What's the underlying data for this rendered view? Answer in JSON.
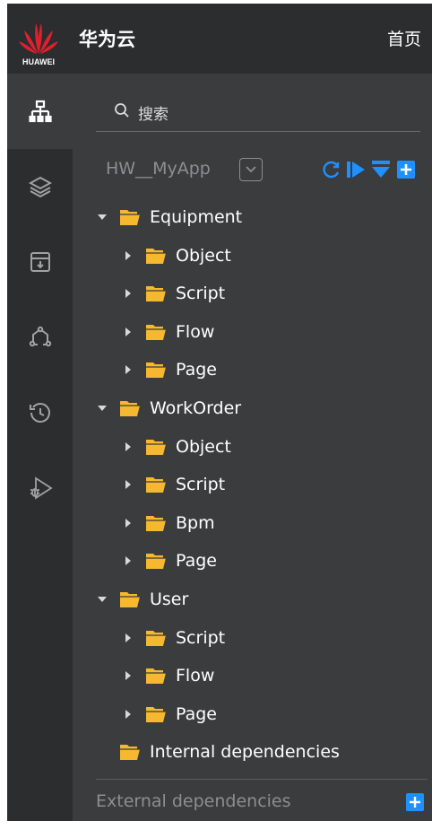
{
  "header": {
    "logo_text": "HUAWEI",
    "brand": "华为云",
    "nav_home": "首页"
  },
  "rail": {
    "items": [
      {
        "icon": "sitemap-icon",
        "active": true
      },
      {
        "icon": "layers-icon",
        "active": false
      },
      {
        "icon": "archive-download-icon",
        "active": false
      },
      {
        "icon": "network-nodes-icon",
        "active": false
      },
      {
        "icon": "history-icon",
        "active": false
      },
      {
        "icon": "debug-run-icon",
        "active": false
      }
    ]
  },
  "search": {
    "label": "搜索"
  },
  "app": {
    "name": "HW__MyApp",
    "tools": [
      "refresh-icon",
      "run-icon",
      "collapse-all-icon",
      "add-icon"
    ]
  },
  "tree": [
    {
      "label": "Equipment",
      "level": 0,
      "expanded": true
    },
    {
      "label": "Object",
      "level": 1,
      "expanded": false
    },
    {
      "label": "Script",
      "level": 1,
      "expanded": false
    },
    {
      "label": "Flow",
      "level": 1,
      "expanded": false
    },
    {
      "label": "Page",
      "level": 1,
      "expanded": false
    },
    {
      "label": "WorkOrder",
      "level": 0,
      "expanded": true
    },
    {
      "label": "Object",
      "level": 1,
      "expanded": false
    },
    {
      "label": "Script",
      "level": 1,
      "expanded": false
    },
    {
      "label": "Bpm",
      "level": 1,
      "expanded": false
    },
    {
      "label": "Page",
      "level": 1,
      "expanded": false
    },
    {
      "label": "User",
      "level": 0,
      "expanded": true
    },
    {
      "label": "Script",
      "level": 1,
      "expanded": false
    },
    {
      "label": "Flow",
      "level": 1,
      "expanded": false
    },
    {
      "label": "Page",
      "level": 1,
      "expanded": false
    },
    {
      "label": "Internal dependencies",
      "level": 0,
      "expanded": null
    }
  ],
  "footer": {
    "external_label": "External dependencies"
  },
  "colors": {
    "accent": "#1e90ff",
    "folder": "#f5b82e",
    "rail_bg": "#2c2d2f",
    "panel_bg": "#3a3c3e"
  }
}
